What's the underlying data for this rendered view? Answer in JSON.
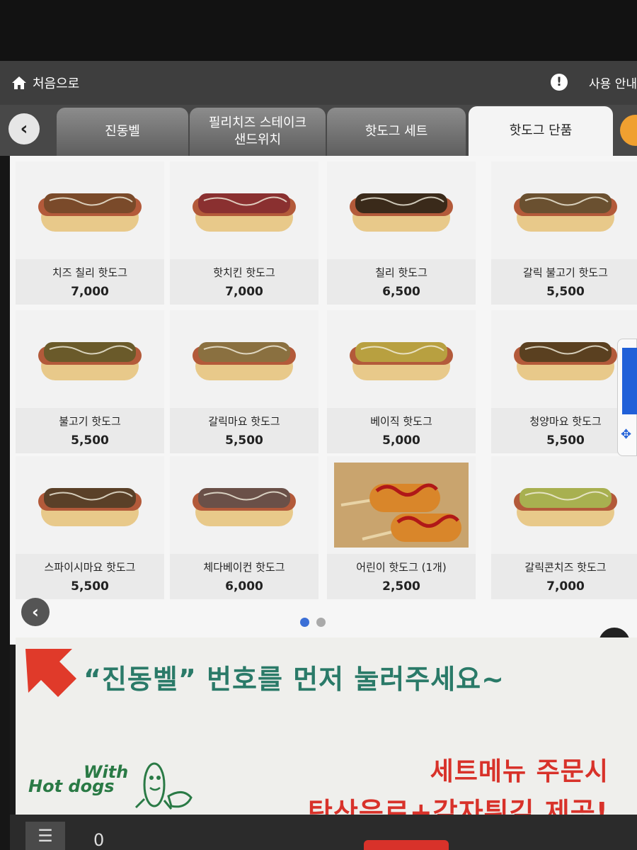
{
  "header": {
    "home_label": "처음으로",
    "help_label": "사용 안내"
  },
  "tabs": [
    {
      "label": "진동벨",
      "active": false
    },
    {
      "label": "필리치즈 스테이크\n샌드위치",
      "active": false
    },
    {
      "label": "핫도그 세트",
      "active": false
    },
    {
      "label": "핫도그 단품",
      "active": true
    }
  ],
  "menu": [
    {
      "name": "치즈 칠리 핫도그",
      "price": "7,000",
      "icon": "hotdog-cheese-chili"
    },
    {
      "name": "핫치킨 핫도그",
      "price": "7,000",
      "icon": "hotdog-hot-chicken"
    },
    {
      "name": "칠리 핫도그",
      "price": "6,500",
      "icon": "hotdog-chili"
    },
    {
      "name": "갈릭 불고기 핫도그",
      "price": "5,500",
      "icon": "hotdog-garlic-bulgogi"
    },
    {
      "name": "불고기 핫도그",
      "price": "5,500",
      "icon": "hotdog-bulgogi"
    },
    {
      "name": "갈릭마요 핫도그",
      "price": "5,500",
      "icon": "hotdog-garlic-mayo"
    },
    {
      "name": "베이직 핫도그",
      "price": "5,000",
      "icon": "hotdog-basic"
    },
    {
      "name": "청양마요 핫도그",
      "price": "5,500",
      "icon": "hotdog-cheongyang-mayo"
    },
    {
      "name": "스파이시마요 핫도그",
      "price": "5,500",
      "icon": "hotdog-spicy-mayo"
    },
    {
      "name": "체다베이컨 핫도그",
      "price": "6,000",
      "icon": "hotdog-cheddar-bacon"
    },
    {
      "name": "어린이 핫도그 (1개)",
      "price": "2,500",
      "icon": "corndog-kids"
    },
    {
      "name": "갈릭콘치즈 핫도그",
      "price": "7,000",
      "icon": "hotdog-garlic-corn-cheese"
    }
  ],
  "pagination": {
    "current": 1,
    "total": 2
  },
  "banner": {
    "notice": "“진동벨” 번호를 먼저 눌러주세요~",
    "logo_with": "With",
    "logo_hotdogs": "Hot dogs",
    "promo_line1": "세트메뉴 주문시",
    "promo_line2": "탄산음료+감자튀김 제공!"
  },
  "cart": {
    "count": "0"
  },
  "colors": {
    "accent_green": "#2a7a68",
    "promo_red": "#d8322a",
    "active_dot": "#3b6fd6"
  }
}
